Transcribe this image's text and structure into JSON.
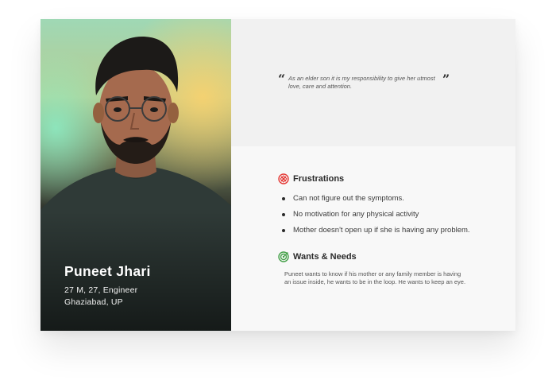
{
  "persona": {
    "name": "Puneet Jhari",
    "details_line1": "27 M, 27, Engineer",
    "details_line2": "Ghaziabad, UP"
  },
  "quote": {
    "open_mark": "“",
    "text": "As an elder son it is my responsibility to give her utmost love, care and attention.",
    "close_mark": "”"
  },
  "frustrations": {
    "title": "Frustrations",
    "icon": "frustration-icon",
    "icon_color": "#e53935",
    "items": [
      "Can not figure out the symptoms.",
      "No motivation for any physical activity",
      "Mother doesn't open up if she is having any problem."
    ]
  },
  "wants": {
    "title": "Wants & Needs",
    "icon": "target-icon",
    "icon_color": "#43a047",
    "text": "Puneet wants to know if his mother or any family member is having an issue inside, he wants to be in the loop. He wants to keep an eye."
  }
}
